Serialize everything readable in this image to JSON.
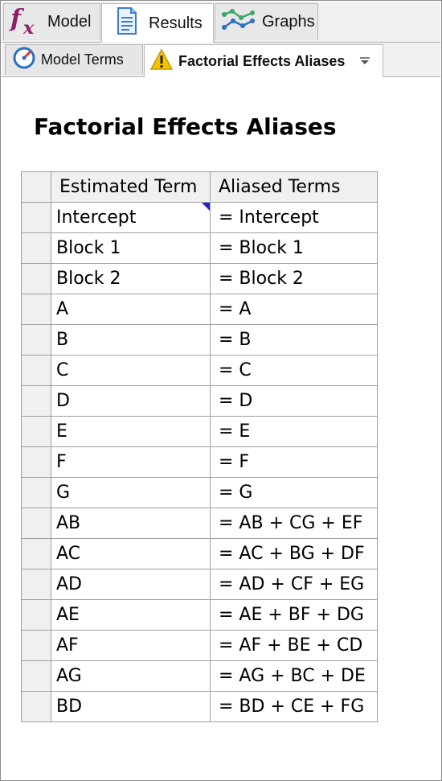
{
  "top_tabs": [
    {
      "label": "Model",
      "icon": "fx-icon",
      "active": false
    },
    {
      "label": "Results",
      "icon": "document-icon",
      "active": true
    },
    {
      "label": "Graphs",
      "icon": "graph-icon",
      "active": false
    }
  ],
  "sub_tabs": [
    {
      "label": "Model Terms",
      "icon": "gauge-icon",
      "active": false
    },
    {
      "label": "Factorial Effects Aliases",
      "icon": "warning-icon",
      "active": true
    }
  ],
  "title": "Factorial Effects Aliases",
  "table": {
    "columns": [
      "Estimated Term",
      "Aliased Terms"
    ],
    "rows": [
      [
        "Intercept",
        "= Intercept"
      ],
      [
        "Block 1",
        "= Block 1"
      ],
      [
        "Block 2",
        "= Block 2"
      ],
      [
        "A",
        "= A"
      ],
      [
        "B",
        "= B"
      ],
      [
        "C",
        "= C"
      ],
      [
        "D",
        "= D"
      ],
      [
        "E",
        "= E"
      ],
      [
        "F",
        "= F"
      ],
      [
        "G",
        "= G"
      ],
      [
        "AB",
        "= AB + CG + EF"
      ],
      [
        "AC",
        "= AC + BG + DF"
      ],
      [
        "AD",
        "= AD + CF + EG"
      ],
      [
        "AE",
        "= AE + BF + DG"
      ],
      [
        "AF",
        "= AF + BE + CD"
      ],
      [
        "AG",
        "= AG + BC + DE"
      ],
      [
        "BD",
        "= BD + CE + FG"
      ]
    ]
  },
  "colors": {
    "fx": "#8e1e6a",
    "warning": "#f5c400",
    "cell_marker": "#1e22c8"
  }
}
